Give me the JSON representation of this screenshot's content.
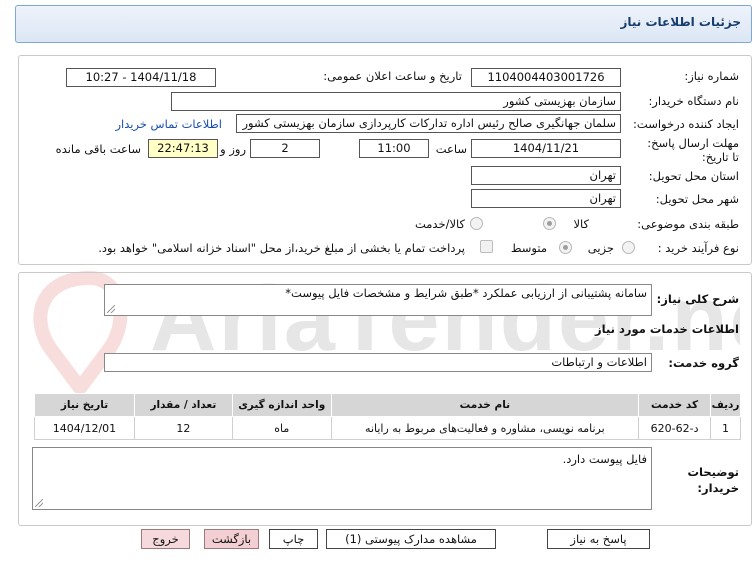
{
  "header": {
    "title": "جزئیات اطلاعات نیاز"
  },
  "form": {
    "need_number_label": "شماره نیاز:",
    "need_number": "1104004403001726",
    "announce_label": "تاریخ و ساعت اعلان عمومی:",
    "announce_value": "1404/11/18 - 10:27",
    "buyer_org_label": "نام دستگاه خریدار:",
    "buyer_org": "سازمان بهزیستی کشور",
    "creator_label": "ایجاد کننده درخواست:",
    "creator": "سلمان جهانگیری صالح رئیس اداره تدارکات کارپردازی سازمان بهزیستی کشور",
    "contact_link": "اطلاعات تماس خریدار",
    "deadline_label": "مهلت ارسال پاسخ: تا تاریخ:",
    "deadline_date": "1404/11/21",
    "time_label": "ساعت",
    "deadline_time": "11:00",
    "days_value": "2",
    "days_label": "روز و",
    "remaining_time": "22:47:13",
    "remaining_label": "ساعت باقی مانده",
    "province_label": "استان محل تحویل:",
    "province": "تهران",
    "city_label": "شهر محل تحویل:",
    "city": "تهران",
    "category_label": "طبقه بندی موضوعی:",
    "category_goods": "کالا",
    "category_goods_service": "کالا/خدمت",
    "process_label": "نوع فرآیند خرید :",
    "process_partial": "جزیی",
    "process_medium": "متوسط",
    "payment_note": "پرداخت تمام یا بخشی از مبلغ خرید،از محل \"اسناد خزانه اسلامی\" خواهد بود."
  },
  "details": {
    "description_label": "شرح کلی نیاز:",
    "description": "سامانه پشتیبانی از ارزیابی عملکرد *طبق شرایط و مشخصات فایل پیوست*",
    "services_title": "اطلاعات خدمات مورد نیاز",
    "service_group_label": "گروه خدمت:",
    "service_group": "اطلاعات و ارتباطات",
    "table": {
      "headers": [
        "ردیف",
        "کد خدمت",
        "نام خدمت",
        "واحد اندازه گیری",
        "تعداد / مقدار",
        "تاریخ نیاز"
      ],
      "rows": [
        [
          "1",
          "د-62-620",
          "برنامه نویسی، مشاوره و فعالیت‌های مربوط به رایانه",
          "ماه",
          "12",
          "1404/12/01"
        ]
      ]
    },
    "buyer_notes_label": "توضیحات خریدار:",
    "buyer_notes": "فایل پیوست دارد."
  },
  "buttons": {
    "reply": "پاسخ به نیاز",
    "attachments": "مشاهده مدارک پیوستی (1)",
    "print": "چاپ",
    "back": "بازگشت",
    "exit": "خروج"
  },
  "watermark": {
    "text": "AriaTender.net"
  }
}
